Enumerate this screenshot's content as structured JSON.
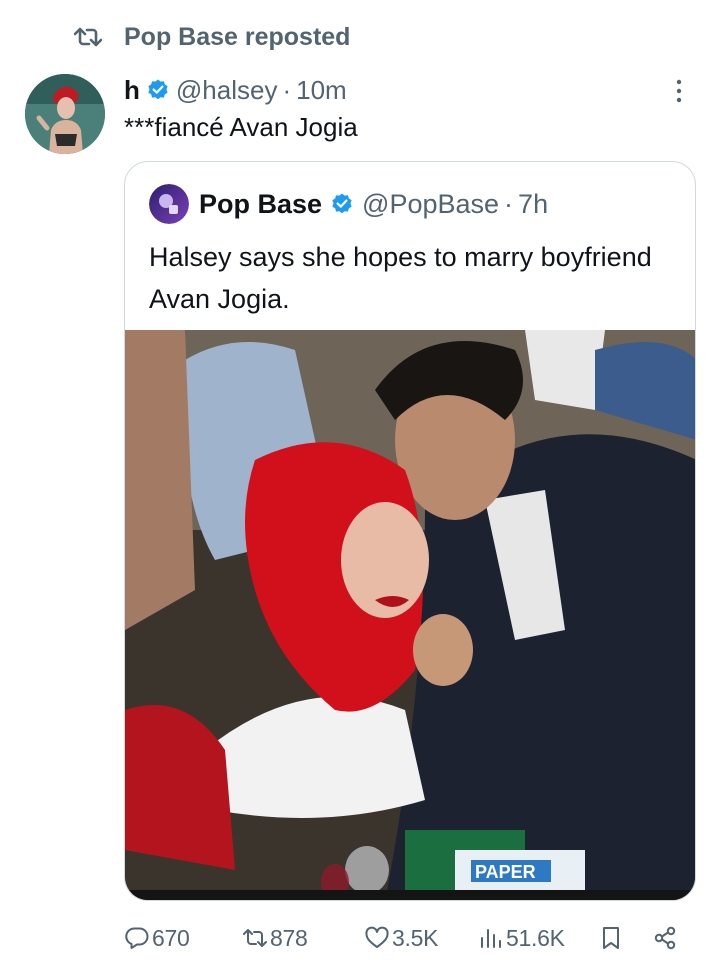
{
  "repost": {
    "label": "Pop Base reposted",
    "icon": "repost-icon"
  },
  "tweet": {
    "display_name": "h",
    "handle": "@halsey",
    "separator": "·",
    "time": "10m",
    "text": "***fiancé Avan Jogia",
    "verified_icon": "verified-badge-icon"
  },
  "quote": {
    "display_name": "Pop Base",
    "handle": "@PopBase",
    "separator": "·",
    "time": "7h",
    "text": "Halsey says she hopes to marry boyfriend Avan Jogia.",
    "media_caption": "PAPER"
  },
  "actions": {
    "replies": "670",
    "reposts": "878",
    "likes": "3.5K",
    "views": "51.6K"
  },
  "colors": {
    "accent": "#1d9bf0",
    "muted": "#536471",
    "text": "#0f1419",
    "border": "#cfd9de"
  }
}
